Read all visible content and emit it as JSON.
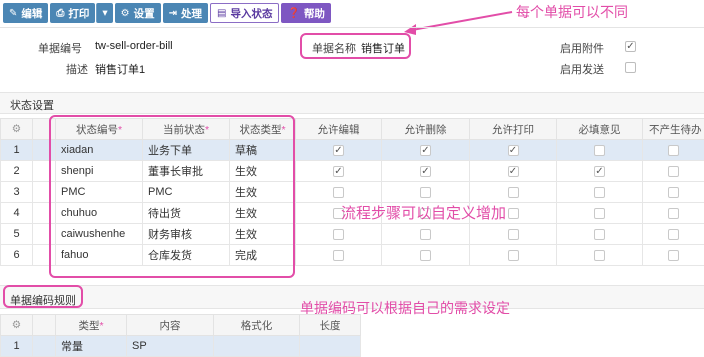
{
  "toolbar": {
    "edit": "编辑",
    "print": "打印",
    "settings": "设置",
    "process": "处理",
    "import_status": "导入状态",
    "help": "帮助"
  },
  "form": {
    "bill_no_label": "单据编号",
    "bill_no_value": "tw-sell-order-bill",
    "bill_name_label": "单据名称",
    "bill_name_value": "销售订单",
    "desc_label": "描述",
    "desc_value": "销售订单1",
    "attach_label": "启用附件",
    "attach_checked": "✓",
    "send_label": "启用发送"
  },
  "annotations": {
    "top": "每个单据可以不同",
    "middle": "流程步骤可以自定义增加",
    "bottom": "单据编码可以根据自己的需求设定"
  },
  "status_section": {
    "title": "状态设置",
    "columns": [
      "状态编号",
      "当前状态",
      "状态类型",
      "允许编辑",
      "允许删除",
      "允许打印",
      "必填意见",
      "不产生待办"
    ],
    "rows": [
      {
        "idx": "1",
        "code": "xiadan",
        "state": "业务下单",
        "type": "草稿",
        "edit": "✓",
        "del": "✓",
        "print": "✓",
        "opinion": "",
        "todo": ""
      },
      {
        "idx": "2",
        "code": "shenpi",
        "state": "董事长审批",
        "type": "生效",
        "edit": "✓",
        "del": "✓",
        "print": "✓",
        "opinion": "✓",
        "todo": ""
      },
      {
        "idx": "3",
        "code": "PMC",
        "state": "PMC",
        "type": "生效",
        "edit": "",
        "del": "",
        "print": "",
        "opinion": "",
        "todo": ""
      },
      {
        "idx": "4",
        "code": "chuhuo",
        "state": "待出货",
        "type": "生效",
        "edit": "",
        "del": "",
        "print": "",
        "opinion": "",
        "todo": ""
      },
      {
        "idx": "5",
        "code": "caiwushenhe",
        "state": "财务审核",
        "type": "生效",
        "edit": "",
        "del": "",
        "print": "",
        "opinion": "",
        "todo": ""
      },
      {
        "idx": "6",
        "code": "fahuo",
        "state": "仓库发货",
        "type": "完成",
        "edit": "",
        "del": "",
        "print": "",
        "opinion": "",
        "todo": ""
      }
    ]
  },
  "rule_section": {
    "title": "单据编码规则",
    "columns": [
      "类型",
      "内容",
      "格式化",
      "长度"
    ],
    "rows": [
      {
        "idx": "1",
        "type": "常量",
        "content": "SP",
        "format": "",
        "length": ""
      }
    ]
  }
}
